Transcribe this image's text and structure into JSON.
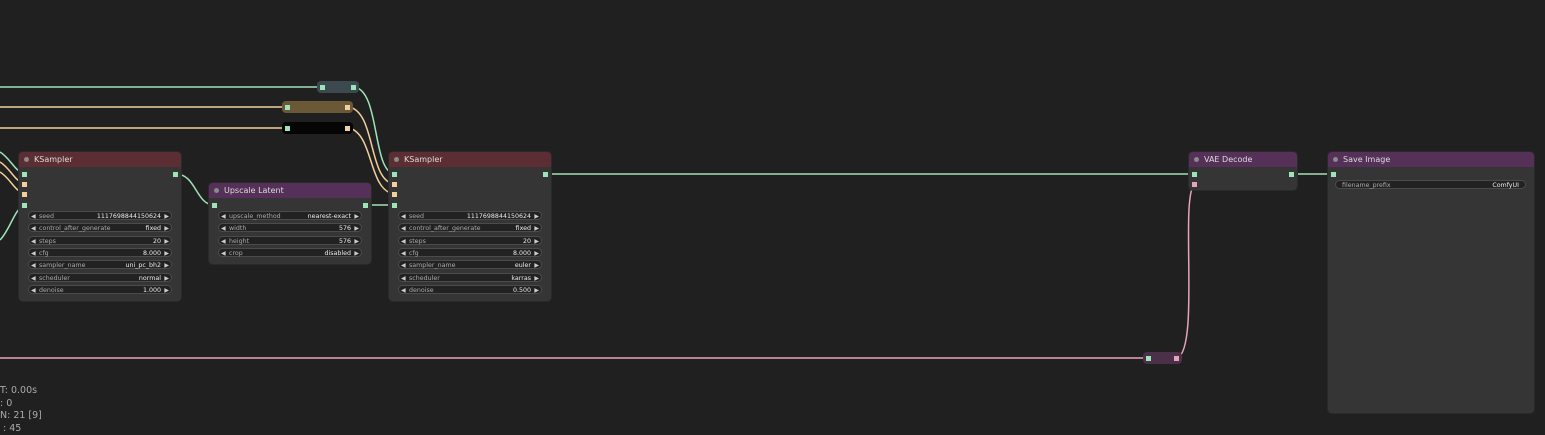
{
  "nodes": {
    "ksampler1": {
      "title": "KSampler",
      "widgets": [
        {
          "label": "seed",
          "value": "1117698844150624"
        },
        {
          "label": "control_after_generate",
          "value": "fixed"
        },
        {
          "label": "steps",
          "value": "20"
        },
        {
          "label": "cfg",
          "value": "8.000"
        },
        {
          "label": "sampler_name",
          "value": "uni_pc_bh2"
        },
        {
          "label": "scheduler",
          "value": "normal"
        },
        {
          "label": "denoise",
          "value": "1.000"
        }
      ]
    },
    "upscale": {
      "title": "Upscale Latent",
      "widgets": [
        {
          "label": "upscale_method",
          "value": "nearest-exact"
        },
        {
          "label": "width",
          "value": "576"
        },
        {
          "label": "height",
          "value": "576"
        },
        {
          "label": "crop",
          "value": "disabled"
        }
      ]
    },
    "ksampler2": {
      "title": "KSampler",
      "widgets": [
        {
          "label": "seed",
          "value": "1117698844150624"
        },
        {
          "label": "control_after_generate",
          "value": "fixed"
        },
        {
          "label": "steps",
          "value": "20"
        },
        {
          "label": "cfg",
          "value": "8.000"
        },
        {
          "label": "sampler_name",
          "value": "euler"
        },
        {
          "label": "scheduler",
          "value": "karras"
        },
        {
          "label": "denoise",
          "value": "0.500"
        }
      ]
    },
    "vae_decode": {
      "title": "VAE Decode"
    },
    "save_image": {
      "title": "Save Image",
      "widgets": [
        {
          "label": "filename_prefix",
          "value": "ComfyUI"
        }
      ]
    }
  },
  "colors": {
    "model": "#9fe3b8",
    "clip": "#f3cf99",
    "vae": "#e7a4b9",
    "ksampler_header": "#5c2e33",
    "latent_header": "#553058"
  },
  "stats": {
    "line1": "T: 0.00s",
    "line2": ": 0",
    "line3": "N: 21 [9]",
    "line4": " : 45"
  }
}
